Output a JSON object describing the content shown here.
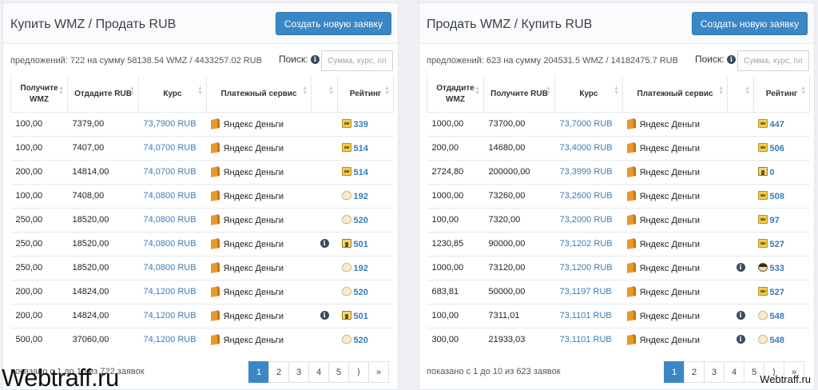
{
  "left": {
    "title": "Купить WMZ / Продать RUB",
    "new_button": "Создать новую заявку",
    "stats": "предложений: 722 на сумму 58138.54 WMZ / 4433257.02 RUB",
    "search_label": "Поиск:",
    "search_placeholder": "Сумма, курс, пла",
    "headers": [
      "Получите WMZ",
      "Отдадите RUB",
      "Курс",
      "Платежный сервис",
      "",
      "Рейтинг"
    ],
    "rows": [
      {
        "a": "100,00",
        "b": "7379,00",
        "rate": "73,7900 RUB",
        "service": "Яндекс Деньги",
        "info": false,
        "badge": "p",
        "rating": "339"
      },
      {
        "a": "100,00",
        "b": "7407,00",
        "rate": "74,0700 RUB",
        "service": "Яндекс Деньги",
        "info": false,
        "badge": "p",
        "rating": "514"
      },
      {
        "a": "200,00",
        "b": "14814,00",
        "rate": "74,0700 RUB",
        "service": "Яндекс Деньги",
        "info": false,
        "badge": "p",
        "rating": "514"
      },
      {
        "a": "100,00",
        "b": "7408,00",
        "rate": "74,0800 RUB",
        "service": "Яндекс Деньги",
        "info": false,
        "badge": "f",
        "rating": "192"
      },
      {
        "a": "250,00",
        "b": "18520,00",
        "rate": "74,0800 RUB",
        "service": "Яндекс Деньги",
        "info": false,
        "badge": "f",
        "rating": "520"
      },
      {
        "a": "250,00",
        "b": "18520,00",
        "rate": "74,0800 RUB",
        "service": "Яндекс Деньги",
        "info": true,
        "badge": "a",
        "rating": "501"
      },
      {
        "a": "250,00",
        "b": "18520,00",
        "rate": "74,0800 RUB",
        "service": "Яндекс Деньги",
        "info": false,
        "badge": "f",
        "rating": "192"
      },
      {
        "a": "200,00",
        "b": "14824,00",
        "rate": "74,1200 RUB",
        "service": "Яндекс Деньги",
        "info": false,
        "badge": "f",
        "rating": "520"
      },
      {
        "a": "200,00",
        "b": "14824,00",
        "rate": "74,1200 RUB",
        "service": "Яндекс Деньги",
        "info": true,
        "badge": "a",
        "rating": "501"
      },
      {
        "a": "500,00",
        "b": "37060,00",
        "rate": "74,1200 RUB",
        "service": "Яндекс Деньги",
        "info": false,
        "badge": "f",
        "rating": "520"
      }
    ],
    "footer": "показано с 1 до 10 из 722 заявок"
  },
  "right": {
    "title": "Продать WMZ / Купить RUB",
    "new_button": "Создать новую заявку",
    "stats": "предложений: 623 на сумму 204531.5 WMZ / 14182475.7 RUB",
    "search_label": "Поиск:",
    "search_placeholder": "Сумма, курс, пла",
    "headers": [
      "Отдадите WMZ",
      "Получите RUB",
      "Курс",
      "Платежный сервис",
      "",
      "Рейтинг"
    ],
    "rows": [
      {
        "a": "1000,00",
        "b": "73700,00",
        "rate": "73,7000 RUB",
        "service": "Яндекс Деньги",
        "info": false,
        "badge": "p",
        "rating": "447"
      },
      {
        "a": "200,00",
        "b": "14680,00",
        "rate": "73,4000 RUB",
        "service": "Яндекс Деньги",
        "info": false,
        "badge": "p",
        "rating": "506"
      },
      {
        "a": "2724,80",
        "b": "200000,00",
        "rate": "73,3999 RUB",
        "service": "Яндекс Деньги",
        "info": false,
        "badge": "a",
        "rating": "0"
      },
      {
        "a": "1000,00",
        "b": "73260,00",
        "rate": "73,2600 RUB",
        "service": "Яндекс Деньги",
        "info": false,
        "badge": "p",
        "rating": "508"
      },
      {
        "a": "100,00",
        "b": "7320,00",
        "rate": "73,2000 RUB",
        "service": "Яндекс Деньги",
        "info": false,
        "badge": "p",
        "rating": "97"
      },
      {
        "a": "1230,85",
        "b": "90000,00",
        "rate": "73,1202 RUB",
        "service": "Яндекс Деньги",
        "info": false,
        "badge": "p",
        "rating": "527"
      },
      {
        "a": "1000,00",
        "b": "73120,00",
        "rate": "73,1200 RUB",
        "service": "Яндекс Деньги",
        "info": true,
        "badge": "u",
        "rating": "533"
      },
      {
        "a": "683,81",
        "b": "50000,00",
        "rate": "73,1197 RUB",
        "service": "Яндекс Деньги",
        "info": false,
        "badge": "p",
        "rating": "527"
      },
      {
        "a": "100,00",
        "b": "7311,01",
        "rate": "73,1101 RUB",
        "service": "Яндекс Деньги",
        "info": true,
        "badge": "f",
        "rating": "548"
      },
      {
        "a": "300,00",
        "b": "21933,03",
        "rate": "73,1101 RUB",
        "service": "Яндекс Деньги",
        "info": true,
        "badge": "f",
        "rating": "548"
      }
    ],
    "footer": "показано с 1 до 10 из 623 заявок"
  },
  "pagination": [
    "1",
    "2",
    "3",
    "4",
    "5",
    "⟩",
    "»"
  ],
  "active_page": "1",
  "info_glyph": "i",
  "watermark_large": "Webtraff.ru",
  "watermark_small": "Webtraff.ru",
  "colors": {
    "accent": "#3b87c5",
    "link": "#3a7bb8",
    "wallet": "#e89a2c"
  }
}
